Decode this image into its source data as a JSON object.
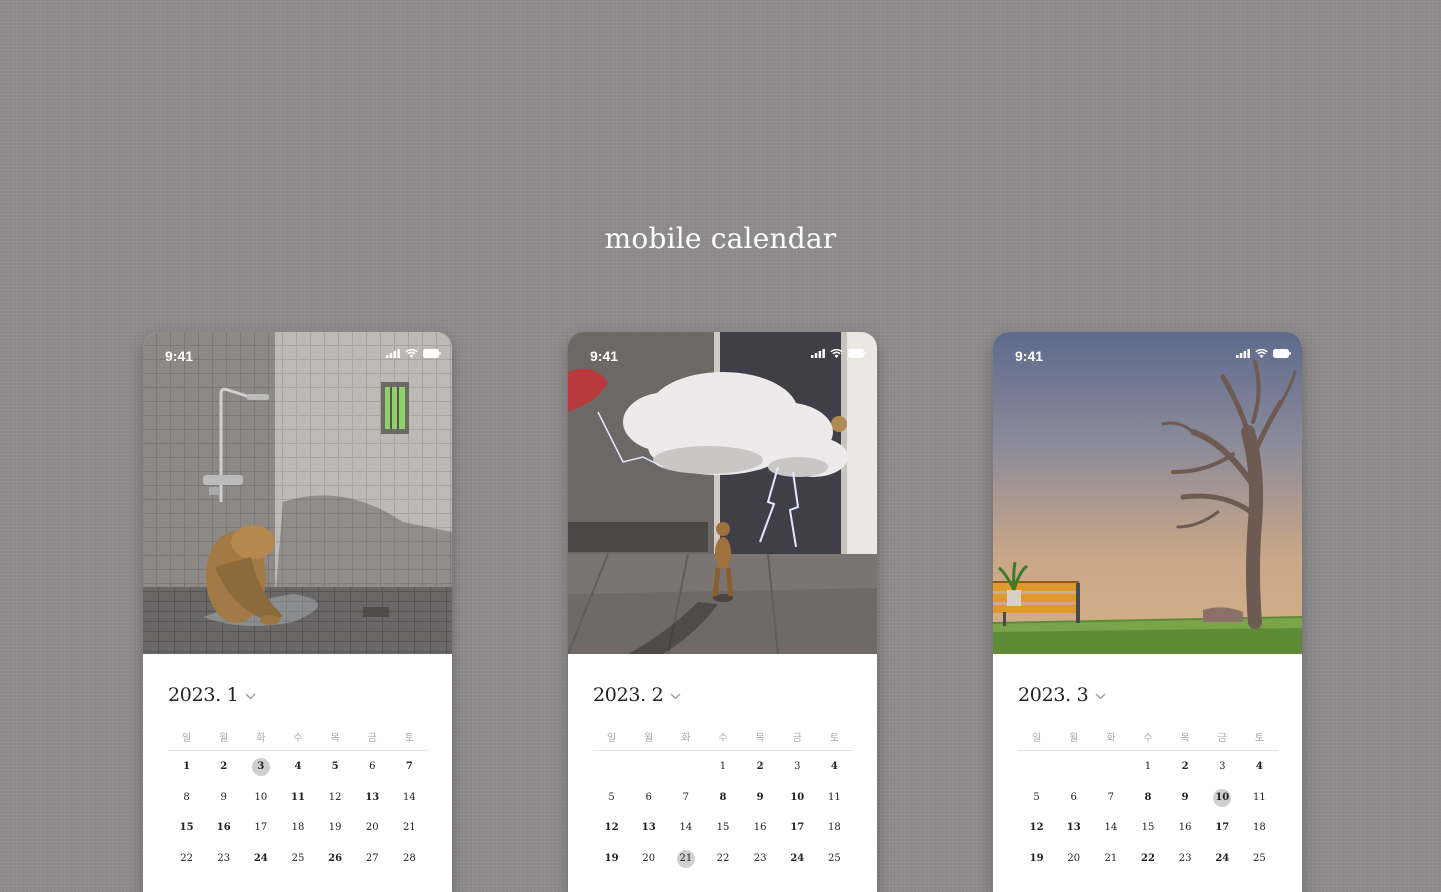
{
  "page": {
    "title": "mobile calendar"
  },
  "status_bar": {
    "time": "9:41"
  },
  "weekdays": [
    "일",
    "월",
    "화",
    "수",
    "목",
    "금",
    "토"
  ],
  "calendars": [
    {
      "month_label": "2023. 1",
      "weeks": [
        [
          {
            "d": "1",
            "b": true
          },
          {
            "d": "2",
            "b": true
          },
          {
            "d": "3",
            "b": true,
            "today": true
          },
          {
            "d": "4",
            "b": true
          },
          {
            "d": "5",
            "b": true
          },
          {
            "d": "6"
          },
          {
            "d": "7",
            "b": true
          }
        ],
        [
          {
            "d": "8"
          },
          {
            "d": "9"
          },
          {
            "d": "10"
          },
          {
            "d": "11",
            "b": true
          },
          {
            "d": "12"
          },
          {
            "d": "13",
            "b": true
          },
          {
            "d": "14"
          }
        ],
        [
          {
            "d": "15",
            "b": true
          },
          {
            "d": "16",
            "b": true
          },
          {
            "d": "17"
          },
          {
            "d": "18"
          },
          {
            "d": "19"
          },
          {
            "d": "20"
          },
          {
            "d": "21"
          }
        ],
        [
          {
            "d": "22"
          },
          {
            "d": "23"
          },
          {
            "d": "24",
            "b": true
          },
          {
            "d": "25"
          },
          {
            "d": "26",
            "b": true
          },
          {
            "d": "27"
          },
          {
            "d": "28"
          }
        ]
      ]
    },
    {
      "month_label": "2023. 2",
      "weeks": [
        [
          {
            "d": ""
          },
          {
            "d": ""
          },
          {
            "d": ""
          },
          {
            "d": "1"
          },
          {
            "d": "2",
            "b": true
          },
          {
            "d": "3"
          },
          {
            "d": "4",
            "b": true
          }
        ],
        [
          {
            "d": "5"
          },
          {
            "d": "6"
          },
          {
            "d": "7"
          },
          {
            "d": "8",
            "b": true
          },
          {
            "d": "9",
            "b": true
          },
          {
            "d": "10",
            "b": true
          },
          {
            "d": "11"
          }
        ],
        [
          {
            "d": "12",
            "b": true
          },
          {
            "d": "13",
            "b": true
          },
          {
            "d": "14"
          },
          {
            "d": "15"
          },
          {
            "d": "16"
          },
          {
            "d": "17",
            "b": true
          },
          {
            "d": "18"
          }
        ],
        [
          {
            "d": "19",
            "b": true
          },
          {
            "d": "20"
          },
          {
            "d": "21",
            "today": true
          },
          {
            "d": "22"
          },
          {
            "d": "23"
          },
          {
            "d": "24",
            "b": true
          },
          {
            "d": "25"
          }
        ]
      ]
    },
    {
      "month_label": "2023. 3",
      "weeks": [
        [
          {
            "d": ""
          },
          {
            "d": ""
          },
          {
            "d": ""
          },
          {
            "d": "1"
          },
          {
            "d": "2",
            "b": true
          },
          {
            "d": "3"
          },
          {
            "d": "4",
            "b": true
          }
        ],
        [
          {
            "d": "5"
          },
          {
            "d": "6"
          },
          {
            "d": "7"
          },
          {
            "d": "8",
            "b": true
          },
          {
            "d": "9",
            "b": true
          },
          {
            "d": "10",
            "b": true,
            "today": true
          },
          {
            "d": "11"
          }
        ],
        [
          {
            "d": "12",
            "b": true
          },
          {
            "d": "13",
            "b": true
          },
          {
            "d": "14"
          },
          {
            "d": "15"
          },
          {
            "d": "16"
          },
          {
            "d": "17",
            "b": true
          },
          {
            "d": "18"
          }
        ],
        [
          {
            "d": "19",
            "b": true
          },
          {
            "d": "20"
          },
          {
            "d": "21"
          },
          {
            "d": "22",
            "b": true
          },
          {
            "d": "23"
          },
          {
            "d": "24",
            "b": true
          },
          {
            "d": "25"
          }
        ]
      ]
    }
  ]
}
